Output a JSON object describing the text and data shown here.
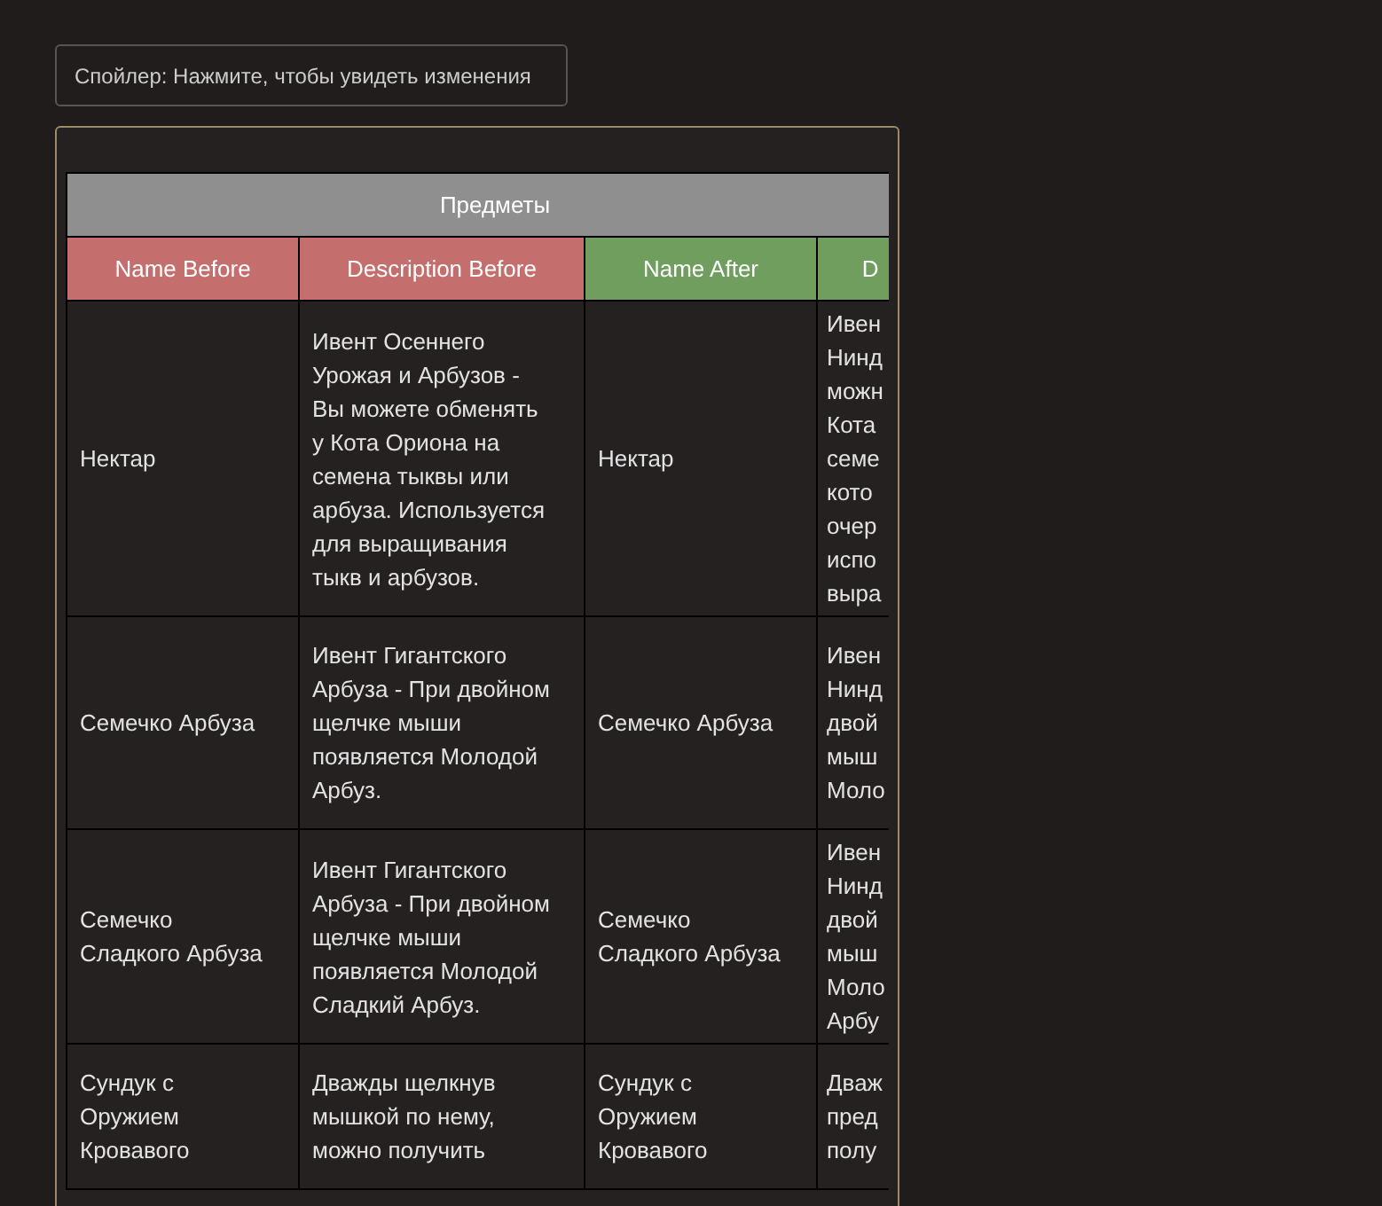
{
  "spoiler_button": {
    "label": "Спойлер: Нажмите, чтобы увидеть изменения"
  },
  "table": {
    "title": "Предметы",
    "columns": [
      {
        "label": "Name Before",
        "kind": "before"
      },
      {
        "label": "Description Before",
        "kind": "before"
      },
      {
        "label": "Name After",
        "kind": "after"
      },
      {
        "label": "D",
        "kind": "after"
      }
    ],
    "rows": [
      {
        "cells": [
          "Нектар",
          "Ивент Осеннего Урожая и Арбузов - Вы можете обменять у Кота Ориона на семена тыквы или арбуза. Используется для выращивания тыкв и арбузов.",
          "Нектар",
          "Ивен\nНинд\nможн\nКота\nсеме\nкото\nочер\nиспо\nвыра"
        ]
      },
      {
        "cells": [
          "Семечко Арбуза",
          "Ивент Гигантского Арбуза - При двойном щелчке мыши появляется Молодой Арбуз.",
          "Семечко Арбуза",
          "Ивен\nНинд\nдвой\nмыш\nМоло"
        ]
      },
      {
        "cells": [
          "Семечко Сладкого Арбуза",
          "Ивент Гигантского Арбуза - При двойном щелчке мыши появляется Молодой Сладкий Арбуз.",
          "Семечко Сладкого Арбуза",
          "Ивен\nНинд\nдвой\nмыш\nМоло\nАрбу"
        ]
      },
      {
        "cells": [
          "Сундук с Оружием Кровавого",
          "Дважды щелкнув мышкой по нему, можно получить",
          "Сундук с Оружием Кровавого",
          "Дваж\nпред\nполу"
        ]
      }
    ]
  }
}
